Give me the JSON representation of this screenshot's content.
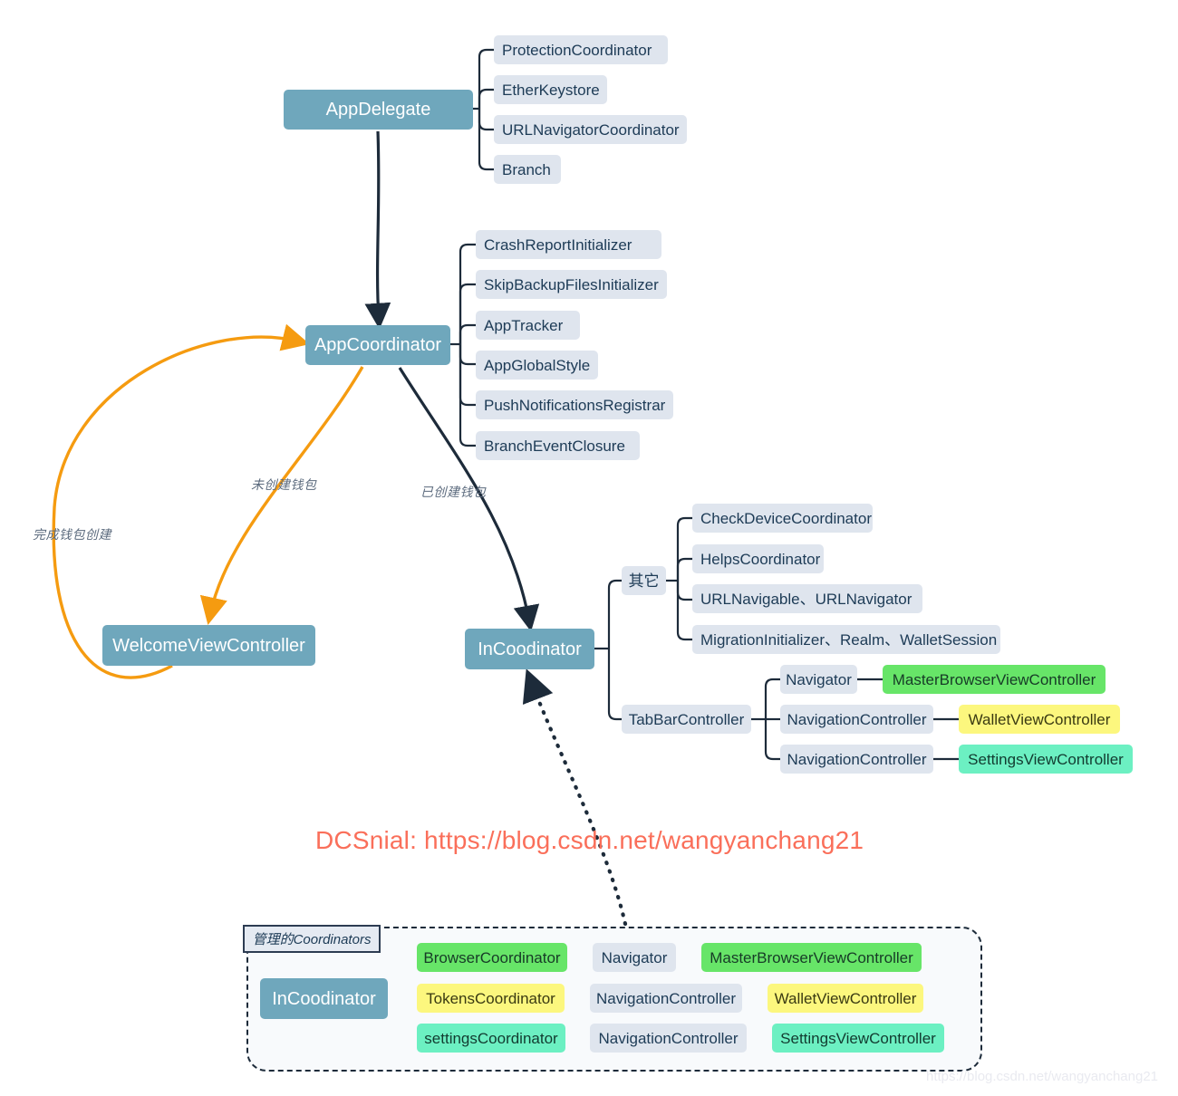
{
  "diagram": {
    "title": "AppDelegate / AppCoordinator architecture mindmap",
    "colors": {
      "main_node": "#6fa7bc",
      "leaf_node": "#dfe5ee",
      "green": "#67e568",
      "yellow": "#fcf77e",
      "mint": "#6cf0c2",
      "edge": "#1d2b3a",
      "edge_orange": "#f59b10",
      "text_dark": "#1d3b56",
      "watermark": "#fa6f5a"
    }
  },
  "nodes": {
    "app_delegate": "AppDelegate",
    "app_coordinator": "AppCoordinator",
    "welcome_vc": "WelcomeViewController",
    "in_coordinator": "InCoodinator",
    "others_group": "其它",
    "tab_bar_controller": "TabBarController"
  },
  "app_delegate_children": [
    "ProtectionCoordinator",
    "EtherKeystore",
    "URLNavigatorCoordinator",
    "Branch"
  ],
  "app_coordinator_children": [
    "CrashReportInitializer",
    "SkipBackupFilesInitializer",
    "AppTracker",
    "AppGlobalStyle",
    "PushNotificationsRegistrar",
    "BranchEventClosure"
  ],
  "others_children": [
    "CheckDeviceCoordinator",
    "HelpsCoordinator",
    "URLNavigable、URLNavigator",
    "MigrationInitializer、Realm、WalletSession"
  ],
  "tabbar_rows": [
    {
      "nav": "Navigator",
      "vc": "MasterBrowserViewController",
      "vc_color": "green"
    },
    {
      "nav": "NavigationController",
      "vc": "WalletViewController",
      "vc_color": "yellow"
    },
    {
      "nav": "NavigationController",
      "vc": "SettingsViewController",
      "vc_color": "mint"
    }
  ],
  "edge_labels": {
    "finish_wallet": "完成钱包创建",
    "no_wallet": "未创建钱包",
    "has_wallet": "已创建钱包"
  },
  "group": {
    "title": "管理的Coordinators",
    "root": "InCoodinator",
    "rows": [
      {
        "coordinator": "BrowserCoordinator",
        "coordinator_color": "green",
        "nav": "Navigator",
        "vc": "MasterBrowserViewController",
        "vc_color": "green"
      },
      {
        "coordinator": "TokensCoordinator",
        "coordinator_color": "yellow",
        "nav": "NavigationController",
        "vc": "WalletViewController",
        "vc_color": "yellow"
      },
      {
        "coordinator": "settingsCoordinator",
        "coordinator_color": "mint",
        "nav": "NavigationController",
        "vc": "SettingsViewController",
        "vc_color": "mint"
      }
    ]
  },
  "watermarks": {
    "main": "DCSnial: https://blog.csdn.net/wangyanchang21",
    "faint": "https://blog.csdn.net/wangyanchang21"
  }
}
